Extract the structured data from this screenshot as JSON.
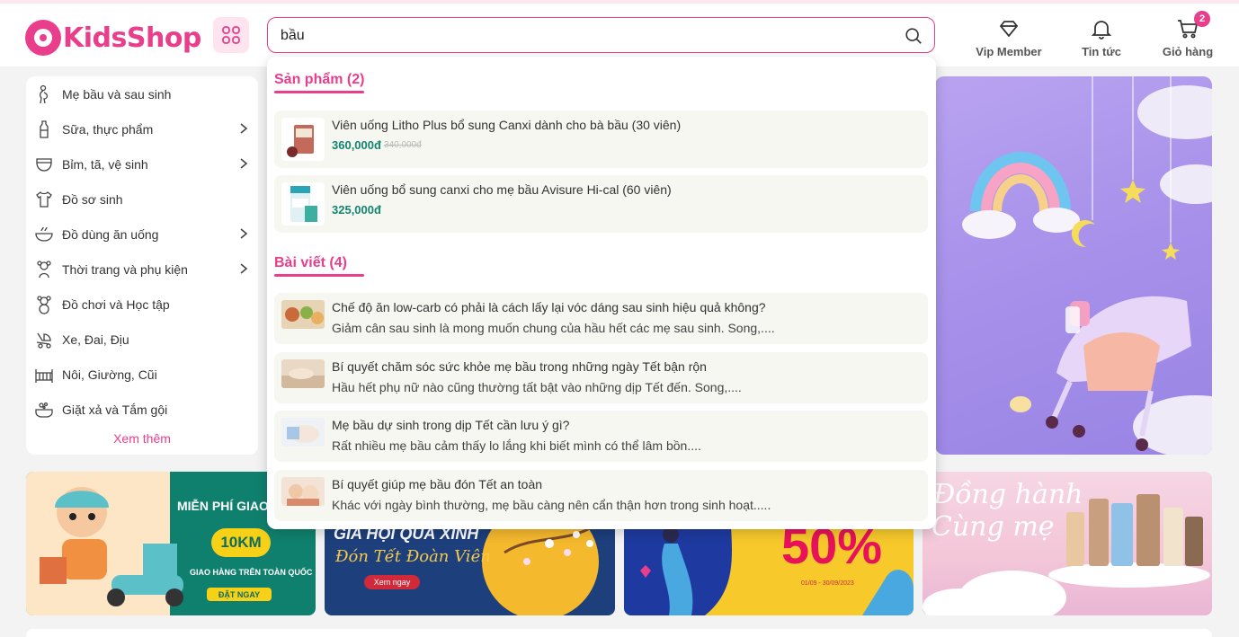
{
  "brand": {
    "name": "KidsShop",
    "accent": "#e83e8c"
  },
  "search": {
    "value": "bầu"
  },
  "header_nav": [
    {
      "label": "Vip Member",
      "icon": "diamond-icon"
    },
    {
      "label": "Tin tức",
      "icon": "bell-icon"
    },
    {
      "label": "Giỏ hàng",
      "icon": "cart-icon",
      "badge": "2"
    }
  ],
  "categories": [
    {
      "label": "Mẹ bầu và sau sinh",
      "icon": "pregnant-icon",
      "has_sub": false
    },
    {
      "label": "Sữa, thực phẩm",
      "icon": "milk-bottle-icon",
      "has_sub": true
    },
    {
      "label": "Bỉm, tã, vệ sinh",
      "icon": "diaper-icon",
      "has_sub": true
    },
    {
      "label": "Đồ sơ sinh",
      "icon": "onesie-icon",
      "has_sub": false
    },
    {
      "label": "Đồ dùng ăn uống",
      "icon": "bowl-icon",
      "has_sub": true
    },
    {
      "label": "Thời trang và phụ kiện",
      "icon": "fashion-icon",
      "has_sub": true
    },
    {
      "label": "Đồ chơi và Học tập",
      "icon": "teddy-bear-icon",
      "has_sub": false
    },
    {
      "label": "Xe, Đai, Địu",
      "icon": "stroller-icon",
      "has_sub": false
    },
    {
      "label": "Nôi, Giường, Cũi",
      "icon": "crib-icon",
      "has_sub": false
    },
    {
      "label": "Giặt xả và Tắm gội",
      "icon": "bath-icon",
      "has_sub": false
    }
  ],
  "see_more": "Xem thêm",
  "dropdown": {
    "products_title": "Sản phẩm (2)",
    "products": [
      {
        "name": "Viên uống Litho Plus bổ sung Canxi dành cho bà bầu (30 viên)",
        "price": "360,000đ",
        "old_price": "340,000đ"
      },
      {
        "name": "Viên uống bổ sung canxi cho mẹ bầu Avisure Hi-cal (60 viên)",
        "price": "325,000đ"
      }
    ],
    "articles_title": "Bài viết (4)",
    "articles": [
      {
        "title": "Chế độ ăn low-carb có phải là cách lấy lại vóc dáng sau sinh hiệu quả không?",
        "excerpt": "Giảm cân sau sinh là mong muốn chung của hầu hết các mẹ sau sinh. Song,...."
      },
      {
        "title": "Bí quyết chăm sóc sức khỏe mẹ bầu trong những ngày Tết bận rộn",
        "excerpt": "Hầu hết phụ nữ nào cũng thường tất bật vào những dịp Tết đến. Song,...."
      },
      {
        "title": "Mẹ bầu dự sinh trong dịp Tết cần lưu ý gì?",
        "excerpt": "Rất nhiều mẹ bầu cảm thấy lo lắng khi biết mình có thể lâm bồn...."
      },
      {
        "title": "Bí quyết giúp mẹ bầu đón Tết an toàn",
        "excerpt": "Khác với ngày bình thường, mẹ bầu càng nên cẩn thận hơn trong sinh hoạt....."
      }
    ]
  },
  "banners": {
    "b1": {
      "headline": "MIỄN PHÍ GIAO",
      "distance": "10KM",
      "sub": "GIAO HÀNG TRÊN TOÀN QUỐC",
      "cta": "ĐẶT NGAY"
    },
    "b2": {
      "headline": "GIA HỘI QUÀ XINH",
      "script": "Đón Tết Đoàn Viên",
      "cta": "Xem ngay"
    },
    "b3": {
      "percent": "50%",
      "dates": "01/09 - 30/09/2023"
    },
    "b4": {
      "script_line1": "Đồng hành",
      "script_line2": "Cùng mẹ"
    }
  }
}
